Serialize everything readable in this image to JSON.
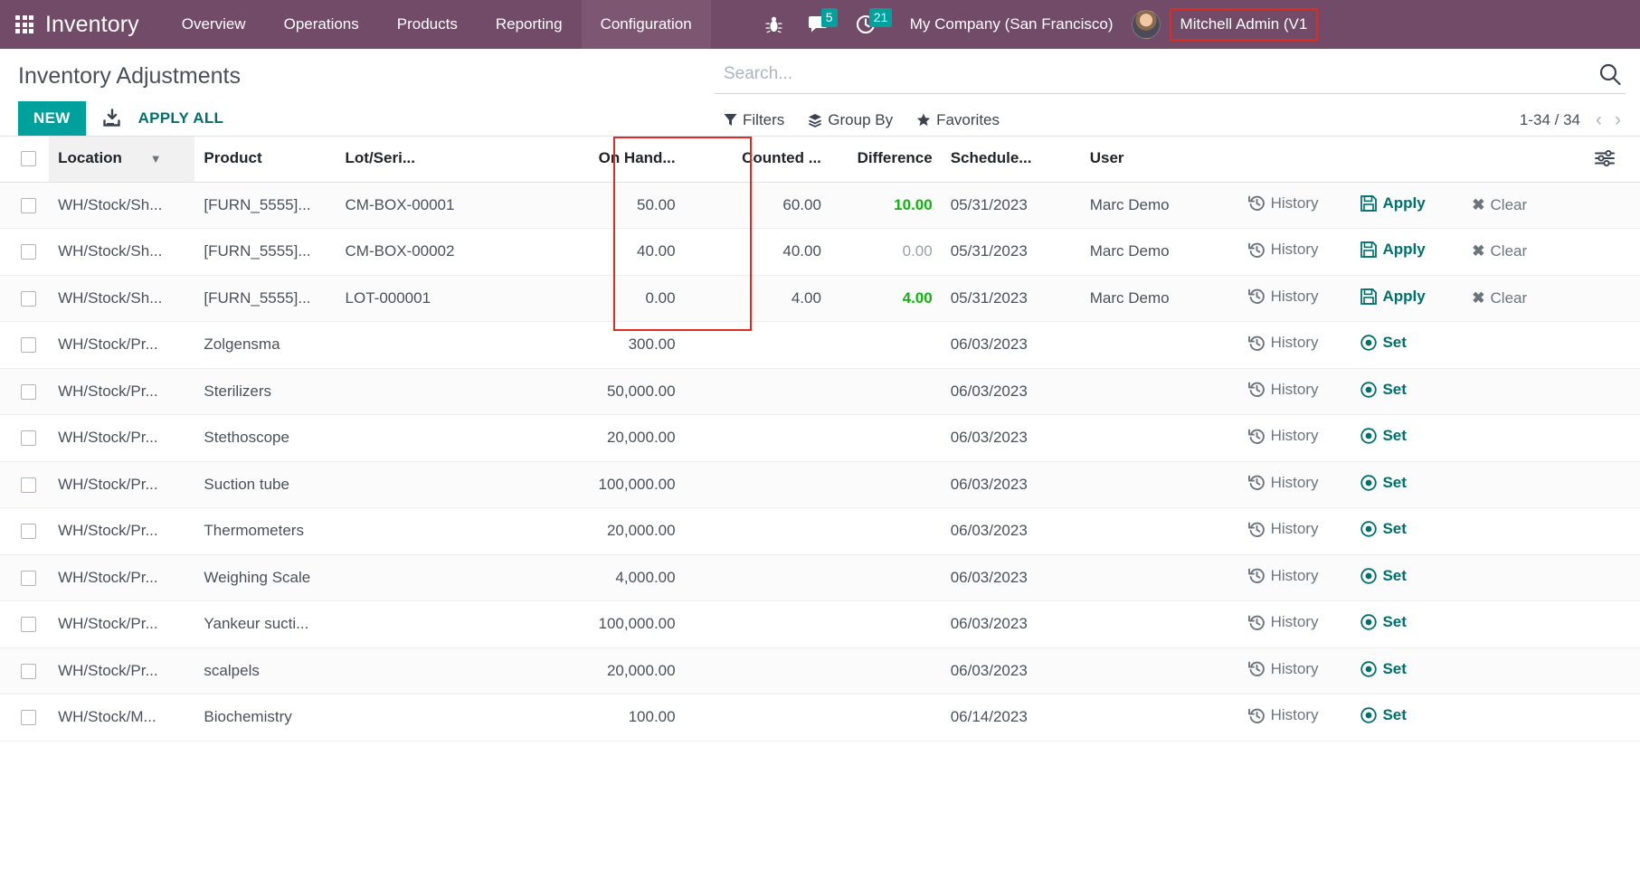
{
  "navbar": {
    "apps_icon": "apps-grid-icon",
    "brand": "Inventory",
    "menu": [
      {
        "label": "Overview",
        "active": false
      },
      {
        "label": "Operations",
        "active": false
      },
      {
        "label": "Products",
        "active": false
      },
      {
        "label": "Reporting",
        "active": false
      },
      {
        "label": "Configuration",
        "active": true
      }
    ],
    "debug_icon": "bug-icon",
    "messages_icon": "chat-bubble-icon",
    "messages_count": "5",
    "activities_icon": "clock-icon",
    "activities_count": "21",
    "company": "My Company (San Francisco)",
    "avatar_icon": "user-avatar",
    "username": "Mitchell Admin (V1",
    "accent": "#714B67",
    "badge_color": "#00A09D",
    "highlight_color": "#e02b20"
  },
  "control_panel": {
    "title": "Inventory Adjustments",
    "new_label": "NEW",
    "download_icon": "import-download-icon",
    "apply_all_label": "APPLY ALL",
    "search": {
      "placeholder": "Search...",
      "value": "",
      "icon": "search-icon"
    },
    "filters": [
      {
        "label": "Filters",
        "icon": "funnel-icon"
      },
      {
        "label": "Group By",
        "icon": "layers-icon"
      },
      {
        "label": "Favorites",
        "icon": "star-icon"
      }
    ],
    "pager": {
      "range": "1-34 / 34",
      "prev_icon": "chevron-left-icon",
      "next_icon": "chevron-right-icon"
    }
  },
  "table": {
    "select_all_icon": "checkbox-icon",
    "optional_columns_icon": "column-settings-icon",
    "sort_icon": "chevron-down-icon",
    "columns": [
      {
        "key": "location",
        "label": "Location",
        "sorted": true
      },
      {
        "key": "product",
        "label": "Product",
        "sorted": false
      },
      {
        "key": "lot",
        "label": "Lot/Seri...",
        "sorted": false
      },
      {
        "key": "on_hand",
        "label": "On Hand...",
        "sorted": false
      },
      {
        "key": "counted",
        "label": "Counted ...",
        "sorted": false
      },
      {
        "key": "difference",
        "label": "Difference",
        "sorted": false
      },
      {
        "key": "scheduled",
        "label": "Schedule...",
        "sorted": false
      },
      {
        "key": "user",
        "label": "User",
        "sorted": false
      }
    ],
    "action_labels": {
      "history": "History",
      "history_icon": "history-clock-icon",
      "apply": "Apply",
      "apply_icon": "floppy-save-icon",
      "clear": "Clear",
      "clear_icon": "x-cross-icon",
      "set": "Set",
      "set_icon": "bullseye-target-icon"
    },
    "rows": [
      {
        "location": "WH/Stock/Sh...",
        "product": "[FURN_5555]...",
        "lot": "CM-BOX-00001",
        "on_hand": "50.00",
        "counted": "60.00",
        "difference": "10.00",
        "difference_state": "positive",
        "scheduled": "05/31/2023",
        "user": "Marc Demo",
        "actions": [
          "history",
          "apply",
          "clear"
        ]
      },
      {
        "location": "WH/Stock/Sh...",
        "product": "[FURN_5555]...",
        "lot": "CM-BOX-00002",
        "on_hand": "40.00",
        "counted": "40.00",
        "difference": "0.00",
        "difference_state": "zero",
        "scheduled": "05/31/2023",
        "user": "Marc Demo",
        "actions": [
          "history",
          "apply",
          "clear"
        ]
      },
      {
        "location": "WH/Stock/Sh...",
        "product": "[FURN_5555]...",
        "lot": "LOT-000001",
        "on_hand": "0.00",
        "counted": "4.00",
        "difference": "4.00",
        "difference_state": "positive",
        "scheduled": "05/31/2023",
        "user": "Marc Demo",
        "actions": [
          "history",
          "apply",
          "clear"
        ]
      },
      {
        "location": "WH/Stock/Pr...",
        "product": "Zolgensma",
        "lot": "",
        "on_hand": "300.00",
        "counted": "",
        "difference": "",
        "difference_state": "none",
        "scheduled": "06/03/2023",
        "user": "",
        "actions": [
          "history",
          "set"
        ]
      },
      {
        "location": "WH/Stock/Pr...",
        "product": "Sterilizers",
        "lot": "",
        "on_hand": "50,000.00",
        "counted": "",
        "difference": "",
        "difference_state": "none",
        "scheduled": "06/03/2023",
        "user": "",
        "actions": [
          "history",
          "set"
        ]
      },
      {
        "location": "WH/Stock/Pr...",
        "product": "Stethoscope",
        "lot": "",
        "on_hand": "20,000.00",
        "counted": "",
        "difference": "",
        "difference_state": "none",
        "scheduled": "06/03/2023",
        "user": "",
        "actions": [
          "history",
          "set"
        ]
      },
      {
        "location": "WH/Stock/Pr...",
        "product": "Suction tube",
        "lot": "",
        "on_hand": "100,000.00",
        "counted": "",
        "difference": "",
        "difference_state": "none",
        "scheduled": "06/03/2023",
        "user": "",
        "actions": [
          "history",
          "set"
        ]
      },
      {
        "location": "WH/Stock/Pr...",
        "product": "Thermometers",
        "lot": "",
        "on_hand": "20,000.00",
        "counted": "",
        "difference": "",
        "difference_state": "none",
        "scheduled": "06/03/2023",
        "user": "",
        "actions": [
          "history",
          "set"
        ]
      },
      {
        "location": "WH/Stock/Pr...",
        "product": "Weighing Scale",
        "lot": "",
        "on_hand": "4,000.00",
        "counted": "",
        "difference": "",
        "difference_state": "none",
        "scheduled": "06/03/2023",
        "user": "",
        "actions": [
          "history",
          "set"
        ]
      },
      {
        "location": "WH/Stock/Pr...",
        "product": "Yankeur sucti...",
        "lot": "",
        "on_hand": "100,000.00",
        "counted": "",
        "difference": "",
        "difference_state": "none",
        "scheduled": "06/03/2023",
        "user": "",
        "actions": [
          "history",
          "set"
        ]
      },
      {
        "location": "WH/Stock/Pr...",
        "product": "scalpels",
        "lot": "",
        "on_hand": "20,000.00",
        "counted": "",
        "difference": "",
        "difference_state": "none",
        "scheduled": "06/03/2023",
        "user": "",
        "actions": [
          "history",
          "set"
        ]
      },
      {
        "location": "WH/Stock/M...",
        "product": "Biochemistry",
        "lot": "",
        "on_hand": "100.00",
        "counted": "",
        "difference": "",
        "difference_state": "none",
        "scheduled": "06/14/2023",
        "user": "",
        "actions": [
          "history",
          "set"
        ]
      }
    ]
  }
}
